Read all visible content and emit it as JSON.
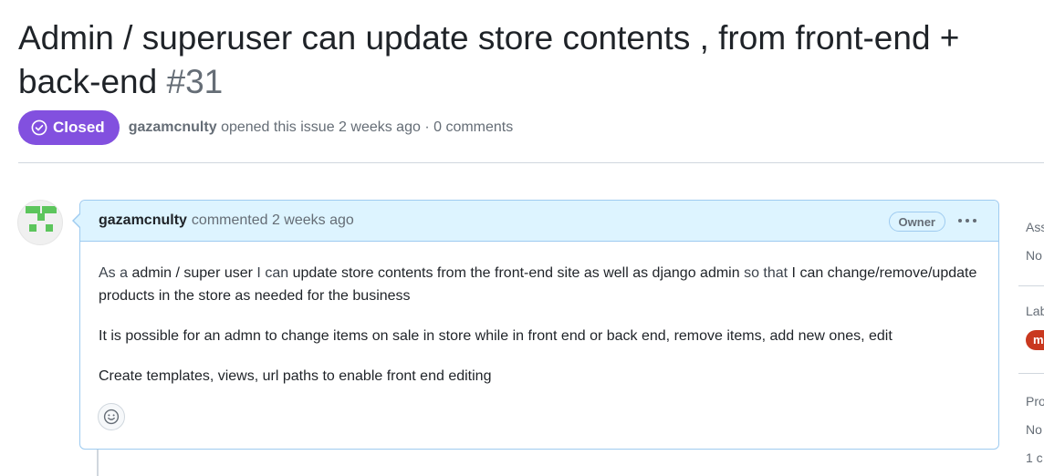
{
  "issue": {
    "title": "Admin / superuser can update store contents , from front-end + back-end",
    "number": "#31",
    "state": "Closed",
    "state_color": "#8250df",
    "author": "gazamcnulty",
    "meta_text": "opened this issue 2 weeks ago · 0 comments"
  },
  "comment": {
    "author": "gazamcnulty",
    "action_text": "commented 2 weeks ago",
    "role_badge": "Owner",
    "menu_icon": "kebab-horizontal-icon",
    "paragraph1": {
      "p1": "As a ",
      "p2": "admin / super user",
      "p3": " I can ",
      "p4": "update store contents from the front-end site as well as django admin",
      "p5": " so that ",
      "p6": "I can change/remove/update products in the store as needed for the business"
    },
    "paragraph2": "It is possible for an admn to change items on sale in store while in front end or back end, remove items, add new ones, edit",
    "paragraph3": "Create templates, views, url paths to enable front end editing",
    "reaction_icon": "smiley-icon"
  },
  "sidebar": {
    "assignees_label": "Ass",
    "assignees_value": "No",
    "labels_label": "Lab",
    "label_tag": "m",
    "label_color": "#c9381f",
    "projects_label": "Pro",
    "projects_value": "No",
    "extra_value": "1 c"
  }
}
